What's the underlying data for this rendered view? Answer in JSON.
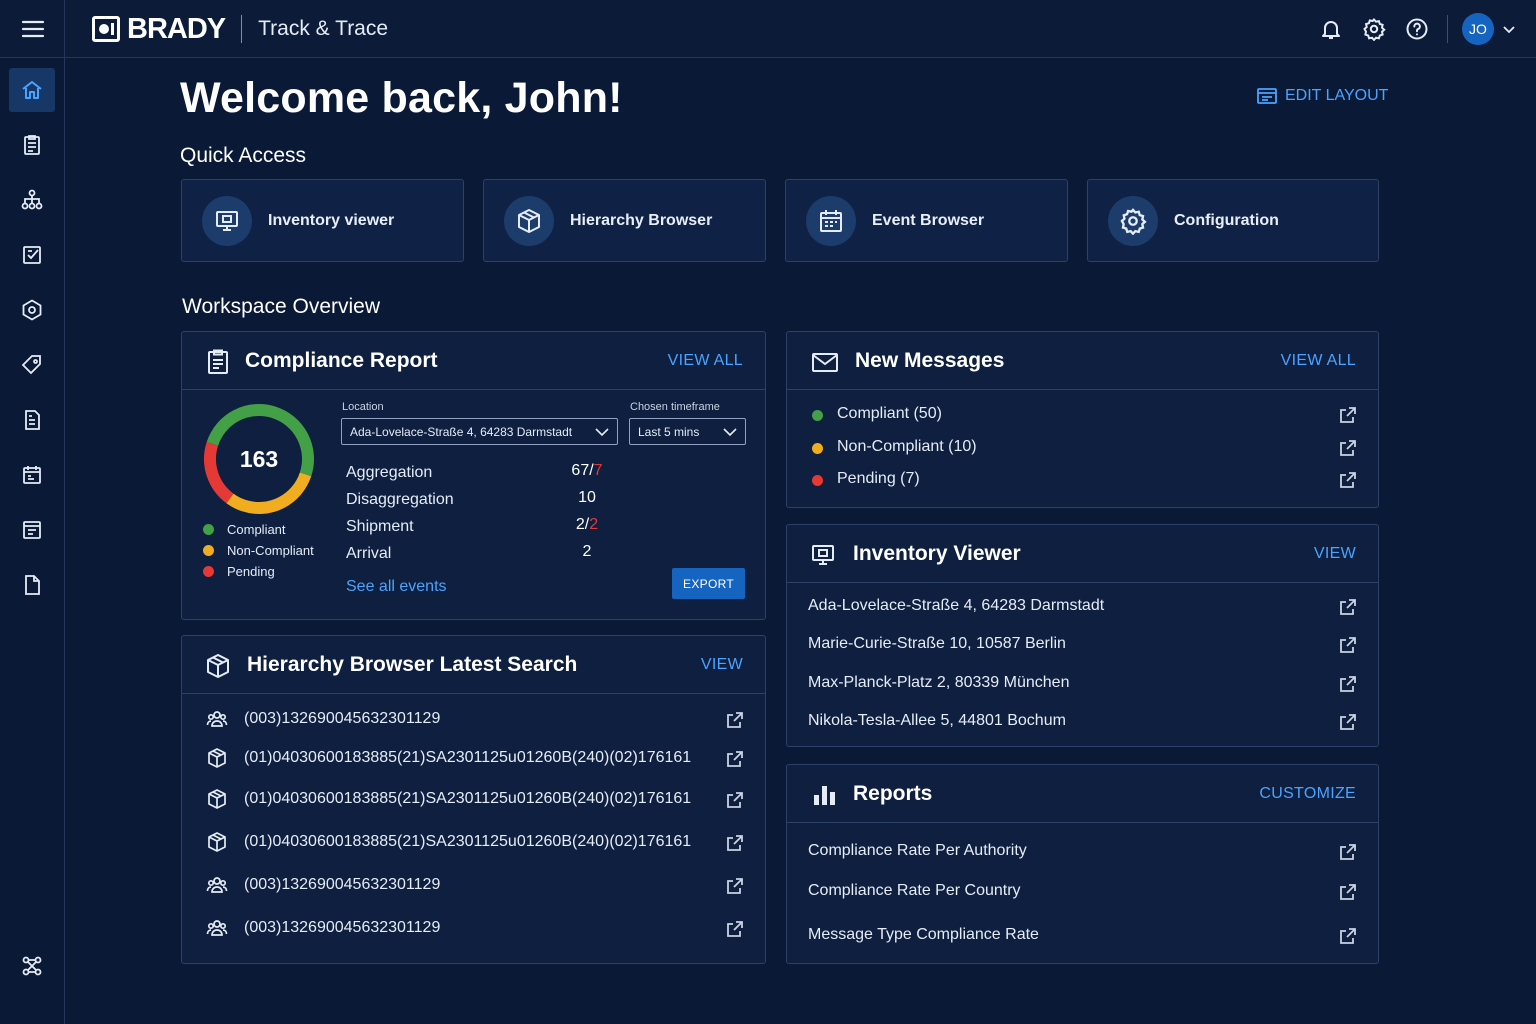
{
  "header": {
    "logo_text": "BRADY",
    "app_name": "Track & Trace",
    "avatar_initials": "JO"
  },
  "icons": {
    "menu": "hamburger-icon",
    "notifications": "bell-icon",
    "settings": "gear-icon",
    "help": "help-icon",
    "account_menu": "chevron-down-icon"
  },
  "sidebar": {
    "items": [
      {
        "icon": "home-icon",
        "active": true
      },
      {
        "icon": "clipboard-icon"
      },
      {
        "icon": "hierarchy-icon"
      },
      {
        "icon": "checklist-icon"
      },
      {
        "icon": "package-settings-icon"
      },
      {
        "icon": "tag-icon"
      },
      {
        "icon": "report-document-icon"
      },
      {
        "icon": "calendar-icon"
      },
      {
        "icon": "archive-icon"
      },
      {
        "icon": "file-icon"
      },
      {
        "icon": "integrations-icon"
      }
    ]
  },
  "main": {
    "welcome": "Welcome back, John!",
    "edit_layout": "EDIT LAYOUT",
    "quick_access_title": "Quick Access",
    "quick_access": [
      {
        "label": "Inventory viewer",
        "icon": "monitor-icon"
      },
      {
        "label": "Hierarchy Browser",
        "icon": "box-icon"
      },
      {
        "label": "Event Browser",
        "icon": "calendar-icon"
      },
      {
        "label": "Configuration",
        "icon": "gear-icon"
      }
    ],
    "workspace_title": "Workspace Overview"
  },
  "compliance": {
    "title": "Compliance Report",
    "action": "VIEW ALL",
    "total": "163",
    "legend": [
      {
        "label": "Compliant",
        "color": "#43a047"
      },
      {
        "label": "Non-Compliant",
        "color": "#f0ad1f"
      },
      {
        "label": "Pending",
        "color": "#e53935"
      }
    ],
    "location_label": "Location",
    "location_value": "Ada-Lovelace-Straße 4, 64283 Darmstadt",
    "timeframe_label": "Chosen timeframe",
    "timeframe_value": "Last 5 mins",
    "stats": [
      {
        "label": "Aggregation",
        "value": "67",
        "error": "7"
      },
      {
        "label": "Disaggregation",
        "value": "10",
        "error": null
      },
      {
        "label": "Shipment",
        "value": "2",
        "error": "2"
      },
      {
        "label": "Arrival",
        "value": "2",
        "error": null
      }
    ],
    "see_all": "See all events",
    "export": "EXPORT"
  },
  "hierarchy": {
    "title": "Hierarchy Browser Latest Search",
    "action": "VIEW",
    "items": [
      {
        "code": "(003)132690045632301129",
        "icon": "users-icon"
      },
      {
        "code": "(01)04030600183885(21)SA2301125u01260B(240)(02)176161",
        "icon": "box-icon"
      },
      {
        "code": "(01)04030600183885(21)SA2301125u01260B(240)(02)176161",
        "icon": "box-icon"
      },
      {
        "code": "(01)04030600183885(21)SA2301125u01260B(240)(02)176161",
        "icon": "box-icon"
      },
      {
        "code": "(003)132690045632301129",
        "icon": "users-icon"
      },
      {
        "code": "(003)132690045632301129",
        "icon": "users-icon"
      }
    ]
  },
  "messages": {
    "title": "New Messages",
    "action": "VIEW ALL",
    "items": [
      {
        "label": "Compliant (50)",
        "color": "#43a047"
      },
      {
        "label": "Non-Compliant (10)",
        "color": "#f0ad1f"
      },
      {
        "label": "Pending (7)",
        "color": "#e53935"
      }
    ]
  },
  "inventory": {
    "title": "Inventory Viewer",
    "action": "VIEW",
    "items": [
      "Ada-Lovelace-Straße 4, 64283 Darmstadt",
      "Marie-Curie-Straße 10, 10587 Berlin",
      "Max-Planck-Platz 2, 80339 München",
      "Nikola-Tesla-Allee 5, 44801 Bochum"
    ]
  },
  "reports": {
    "title": "Reports",
    "action": "CUSTOMIZE",
    "items": [
      "Compliance Rate Per Authority",
      "Compliance Rate Per Country",
      "Message Type Compliance Rate"
    ]
  },
  "chart_data": {
    "type": "pie",
    "categories": [
      "Compliant",
      "Non-Compliant",
      "Pending"
    ],
    "values": [
      50,
      30,
      20
    ],
    "colors": [
      "#43a047",
      "#f0ad1f",
      "#e53935"
    ]
  }
}
